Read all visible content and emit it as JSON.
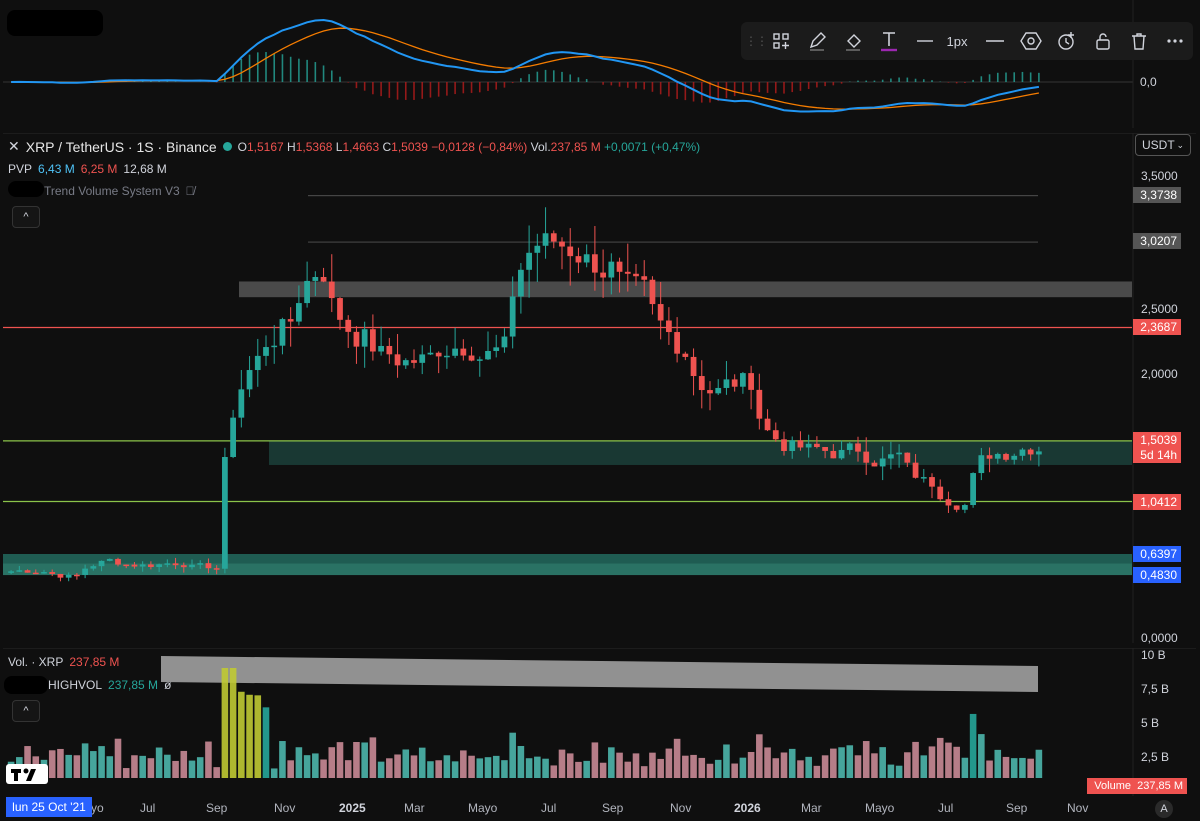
{
  "toolbar": {
    "grip": "⋮⋮",
    "line_width_label": "1px",
    "items": [
      "layout-icon",
      "pencil-icon",
      "fill-icon",
      "text-tool-icon",
      "line-style-icon",
      "line-width",
      "line-icon",
      "settings-hexagon-icon",
      "add-alert-icon",
      "lock-icon",
      "trash-icon",
      "more-icon"
    ]
  },
  "macd_pane": {
    "zero_label": "0,0"
  },
  "header": {
    "symbol_title": "XRP / TetherUS · 1S · Binance",
    "ohlc": {
      "o_label": "O",
      "o": "1,5167",
      "h_label": "H",
      "h": "1,5368",
      "l_label": "L",
      "l": "1,4663",
      "c_label": "C",
      "c": "1,5039",
      "change": "−0,0128 (−0,84%)"
    },
    "vol_label": "Vol.",
    "vol": "237,85 M",
    "vol_change": "+0,0071 (+0,47%)",
    "currency": "USDT"
  },
  "pvp": {
    "name": "PVP",
    "v1": "6,43 M",
    "v2": "6,25 M",
    "v3": "12,68 M"
  },
  "indicator2": {
    "name": "Trend Volume System V3"
  },
  "price_scale": {
    "ticks": [
      "3,5000",
      "2,5000",
      "2,0000",
      "0,0000"
    ],
    "labels": {
      "l1": "3,3738",
      "l2": "3,0207",
      "l3": "2,3687",
      "l4": "1,5039",
      "l4_sub": "5d 14h",
      "l5": "1,0412",
      "l6": "0,6397",
      "l7": "0,4830"
    }
  },
  "volume_pane": {
    "legend1": "Vol. · XRP",
    "legend1_value": "237,85 M",
    "legend2_name": "HIGHVOL",
    "legend2_value": "237,85 M",
    "legend2_extra": "ø",
    "scale": [
      "10 B",
      "7,5 B",
      "5 B",
      "2,5 B"
    ],
    "volume_tag_label": "Volume",
    "volume_tag_value": "237,85 M"
  },
  "time_axis": {
    "labels": [
      "Jul",
      "Sep",
      "Nov",
      "2025",
      "Mar",
      "Mayo",
      "Jul",
      "Sep",
      "Nov",
      "2026",
      "Mar",
      "Mayo",
      "Jul",
      "Sep",
      "Nov"
    ],
    "partial_label": "yo",
    "cursor_date": "lun 25 Oct '21",
    "auto_button": "A"
  },
  "colors": {
    "up": "#26a69a",
    "down": "#ef5350",
    "macd": "#2196f3",
    "signal": "#f57c00",
    "zone": "#1f5c52",
    "resistance": "#ef5350",
    "support": "#8bc34a",
    "label_blue": "#2962ff"
  },
  "chart_data": {
    "type": "candlestick",
    "symbol": "XRP / TetherUS",
    "interval": "1S",
    "ylim": [
      0,
      3.7
    ],
    "x": [
      "2024-05",
      "2024-06",
      "2024-07",
      "2024-08",
      "2024-09",
      "2024-10",
      "2024-11",
      "2024-12",
      "2025-01",
      "2025-02",
      "2025-03",
      "2025-04",
      "2025-05",
      "2025-06",
      "2025-07",
      "2025-08",
      "2025-09",
      "2025-10",
      "2025-11",
      "2025-12",
      "2026-01",
      "2026-02",
      "2026-03",
      "2026-04",
      "2026-05",
      "2026-06",
      "2026-07",
      "2026-08",
      "2026-09"
    ],
    "close": [
      0.52,
      0.47,
      0.6,
      0.56,
      0.58,
      0.53,
      2.2,
      2.42,
      2.9,
      2.3,
      2.1,
      2.12,
      2.3,
      2.18,
      3.1,
      2.98,
      2.85,
      2.5,
      2.2,
      1.88,
      1.95,
      1.45,
      1.4,
      1.42,
      1.38,
      1.15,
      1.05,
      1.45,
      1.5
    ],
    "levels": [
      {
        "value": 3.3738,
        "label": "3,3738"
      },
      {
        "value": 3.0207,
        "label": "3,0207"
      },
      {
        "value": 2.3687,
        "label": "2,3687"
      },
      {
        "value": 1.5039,
        "label": "1,5039"
      },
      {
        "value": 1.0412,
        "label": "1,0412"
      },
      {
        "value": 0.6397,
        "label": "0,6397"
      },
      {
        "value": 0.483,
        "label": "0,4830"
      }
    ],
    "zones": [
      {
        "from": 2.6,
        "to": 2.72
      },
      {
        "from": 1.32,
        "to": 1.5
      },
      {
        "from": 0.48,
        "to": 0.64
      }
    ]
  }
}
